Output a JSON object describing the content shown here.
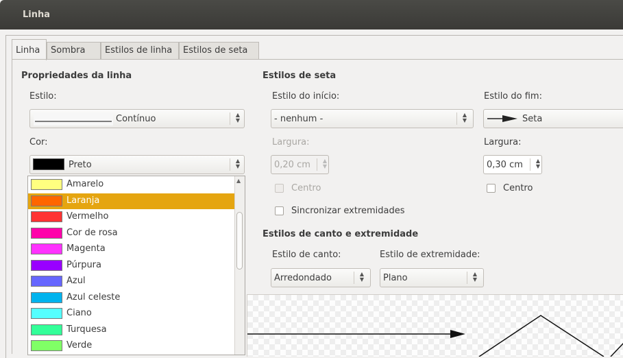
{
  "window": {
    "title": "Linha"
  },
  "tabs": [
    {
      "label": "Linha"
    },
    {
      "label": "Sombra"
    },
    {
      "label": "Estilos de linha"
    },
    {
      "label": "Estilos de seta"
    }
  ],
  "line_props": {
    "header": "Propriedades da linha",
    "style_label": "Estilo:",
    "style_value": "Contínuo",
    "color_label": "Cor:",
    "color_value": "Preto",
    "color_swatch": "#000000"
  },
  "color_dropdown": {
    "items": [
      {
        "label": "Amarelo",
        "color": "#ffff80"
      },
      {
        "label": "Laranja",
        "color": "#ff6600",
        "selected": true
      },
      {
        "label": "Vermelho",
        "color": "#ff3333"
      },
      {
        "label": "Cor de rosa",
        "color": "#ff00aa"
      },
      {
        "label": "Magenta",
        "color": "#ff33ff"
      },
      {
        "label": "Púrpura",
        "color": "#9900ff"
      },
      {
        "label": "Azul",
        "color": "#6666ff"
      },
      {
        "label": "Azul celeste",
        "color": "#00b3ee"
      },
      {
        "label": "Ciano",
        "color": "#55ffff"
      },
      {
        "label": "Turquesa",
        "color": "#33ff99"
      },
      {
        "label": "Verde",
        "color": "#80ff66"
      }
    ]
  },
  "arrow_styles": {
    "header": "Estilos de seta",
    "start_label": "Estilo do início:",
    "start_value": "- nenhum -",
    "end_label": "Estilo do fim:",
    "end_value": "Seta",
    "width_label_start": "Largura:",
    "width_start": "0,20 cm",
    "width_label_end": "Largura:",
    "width_end": "0,30 cm",
    "center_start": "Centro",
    "center_end": "Centro",
    "sync": "Sincronizar extremidades"
  },
  "corner_styles": {
    "header": "Estilos de canto e extremidade",
    "corner_label": "Estilo de canto:",
    "corner_value": "Arredondado",
    "cap_label": "Estilo de extremidade:",
    "cap_value": "Plano"
  },
  "colors": {
    "accent": "#e5a510",
    "titlebar": "#3c3b37"
  }
}
